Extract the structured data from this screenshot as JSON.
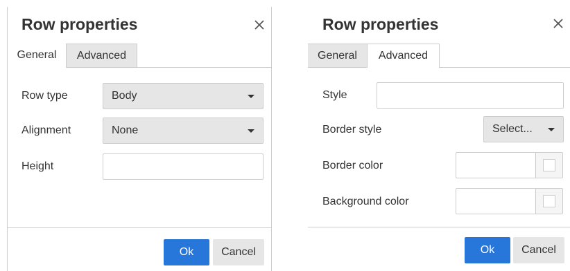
{
  "dialogs": [
    {
      "title": "Row properties",
      "tabs": [
        "General",
        "Advanced"
      ],
      "active_tab": "General",
      "fields": {
        "row_type": {
          "label": "Row type",
          "value": "Body"
        },
        "alignment": {
          "label": "Alignment",
          "value": "None"
        },
        "height": {
          "label": "Height",
          "value": ""
        }
      },
      "buttons": {
        "ok": "Ok",
        "cancel": "Cancel"
      }
    },
    {
      "title": "Row properties",
      "tabs": [
        "General",
        "Advanced"
      ],
      "active_tab": "Advanced",
      "fields": {
        "style": {
          "label": "Style",
          "value": ""
        },
        "border_style": {
          "label": "Border style",
          "value": "Select..."
        },
        "border_color": {
          "label": "Border color",
          "value": ""
        },
        "background_color": {
          "label": "Background color",
          "value": ""
        }
      },
      "buttons": {
        "ok": "Ok",
        "cancel": "Cancel"
      }
    }
  ],
  "icons": {
    "close": "close-icon",
    "dropdown": "caret-down-icon",
    "color_swatch": "color-swatch-icon"
  },
  "colors": {
    "primary_button": "#2776d9",
    "inactive_tab": "#e6e6e6",
    "border": "#cccccc",
    "text": "#333333"
  }
}
